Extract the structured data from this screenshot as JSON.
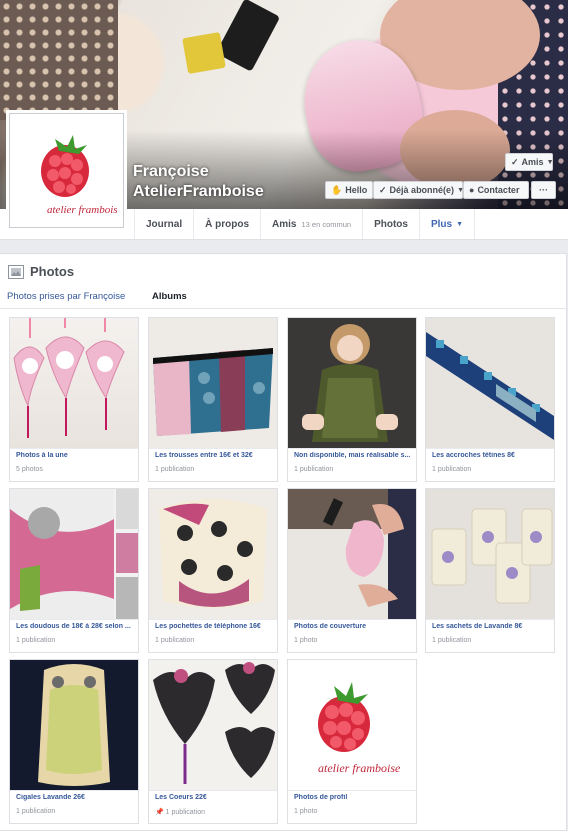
{
  "profile": {
    "name_line1": "Françoise",
    "name_line2": "AtelierFramboise",
    "logo_text": "atelier framboise"
  },
  "actions": {
    "friends_label": "Amis",
    "hello_label": "Hello",
    "subscribed_label": "Déjà abonné(e)",
    "contact_label": "Contacter",
    "more_label": "···"
  },
  "nav": {
    "tabs": [
      {
        "label": "Journal"
      },
      {
        "label": "À propos"
      },
      {
        "label": "Amis",
        "extra": "13 en commun"
      },
      {
        "label": "Photos"
      },
      {
        "label": "Plus"
      }
    ]
  },
  "photos": {
    "title": "Photos",
    "subtab_photos_of": "Photos prises par Françoise",
    "subtab_albums": "Albums",
    "albums": [
      {
        "title": "Photos à la une",
        "count": "5 photos"
      },
      {
        "title": "Les trousses entre 16€ et 32€",
        "count": "1 publication"
      },
      {
        "title": "Non disponible, mais réalisable s...",
        "count": "1 publication"
      },
      {
        "title": "Les accroches tétines 8€",
        "count": "1 publication"
      },
      {
        "title": "Les doudous de 18€ à 28€ selon ...",
        "count": "1 publication"
      },
      {
        "title": "Les pochettes de téléphone 16€",
        "count": "1 publication"
      },
      {
        "title": "Photos de couverture",
        "count": "1 photo"
      },
      {
        "title": "Les sachets de Lavande 8€",
        "count": "1 publication"
      },
      {
        "title": "Cigales Lavande 26€",
        "count": "1 publication"
      },
      {
        "title": "Les Coeurs 22€",
        "count": "1 publication"
      },
      {
        "title": "Photos de profil",
        "count": "1 photo"
      }
    ]
  },
  "colors": {
    "link": "#365899",
    "muted": "#90949c",
    "accent": "#4267b2",
    "raspberry": "#d8283c"
  }
}
